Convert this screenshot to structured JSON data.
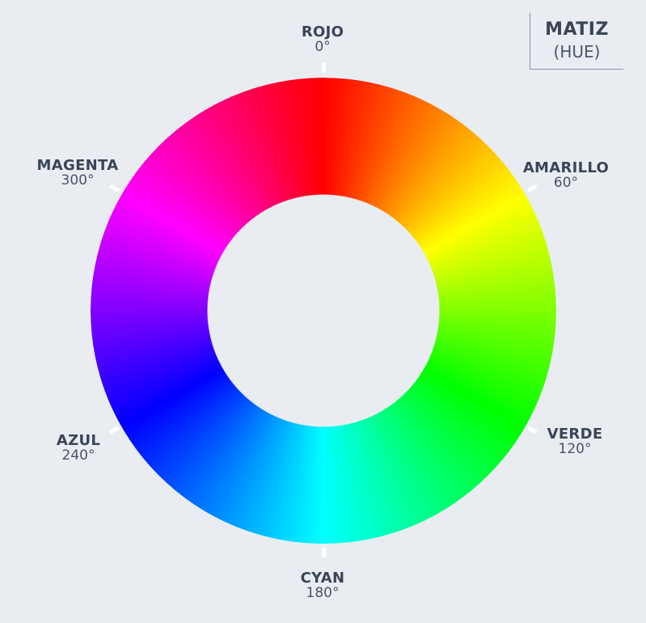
{
  "title": {
    "main": "MATIZ",
    "sub": "(HUE)"
  },
  "hues": [
    {
      "name": "ROJO",
      "degrees": "0°",
      "angle": 0,
      "color": "#ff0000"
    },
    {
      "name": "AMARILLO",
      "degrees": "60°",
      "angle": 60,
      "color": "#ffff00"
    },
    {
      "name": "VERDE",
      "degrees": "120°",
      "angle": 120,
      "color": "#00ff00"
    },
    {
      "name": "CYAN",
      "degrees": "180°",
      "angle": 180,
      "color": "#00ffff"
    },
    {
      "name": "AZUL",
      "degrees": "240°",
      "angle": 240,
      "color": "#0000ff"
    },
    {
      "name": "MAGENTA",
      "degrees": "300°",
      "angle": 300,
      "color": "#ff00ff"
    }
  ]
}
